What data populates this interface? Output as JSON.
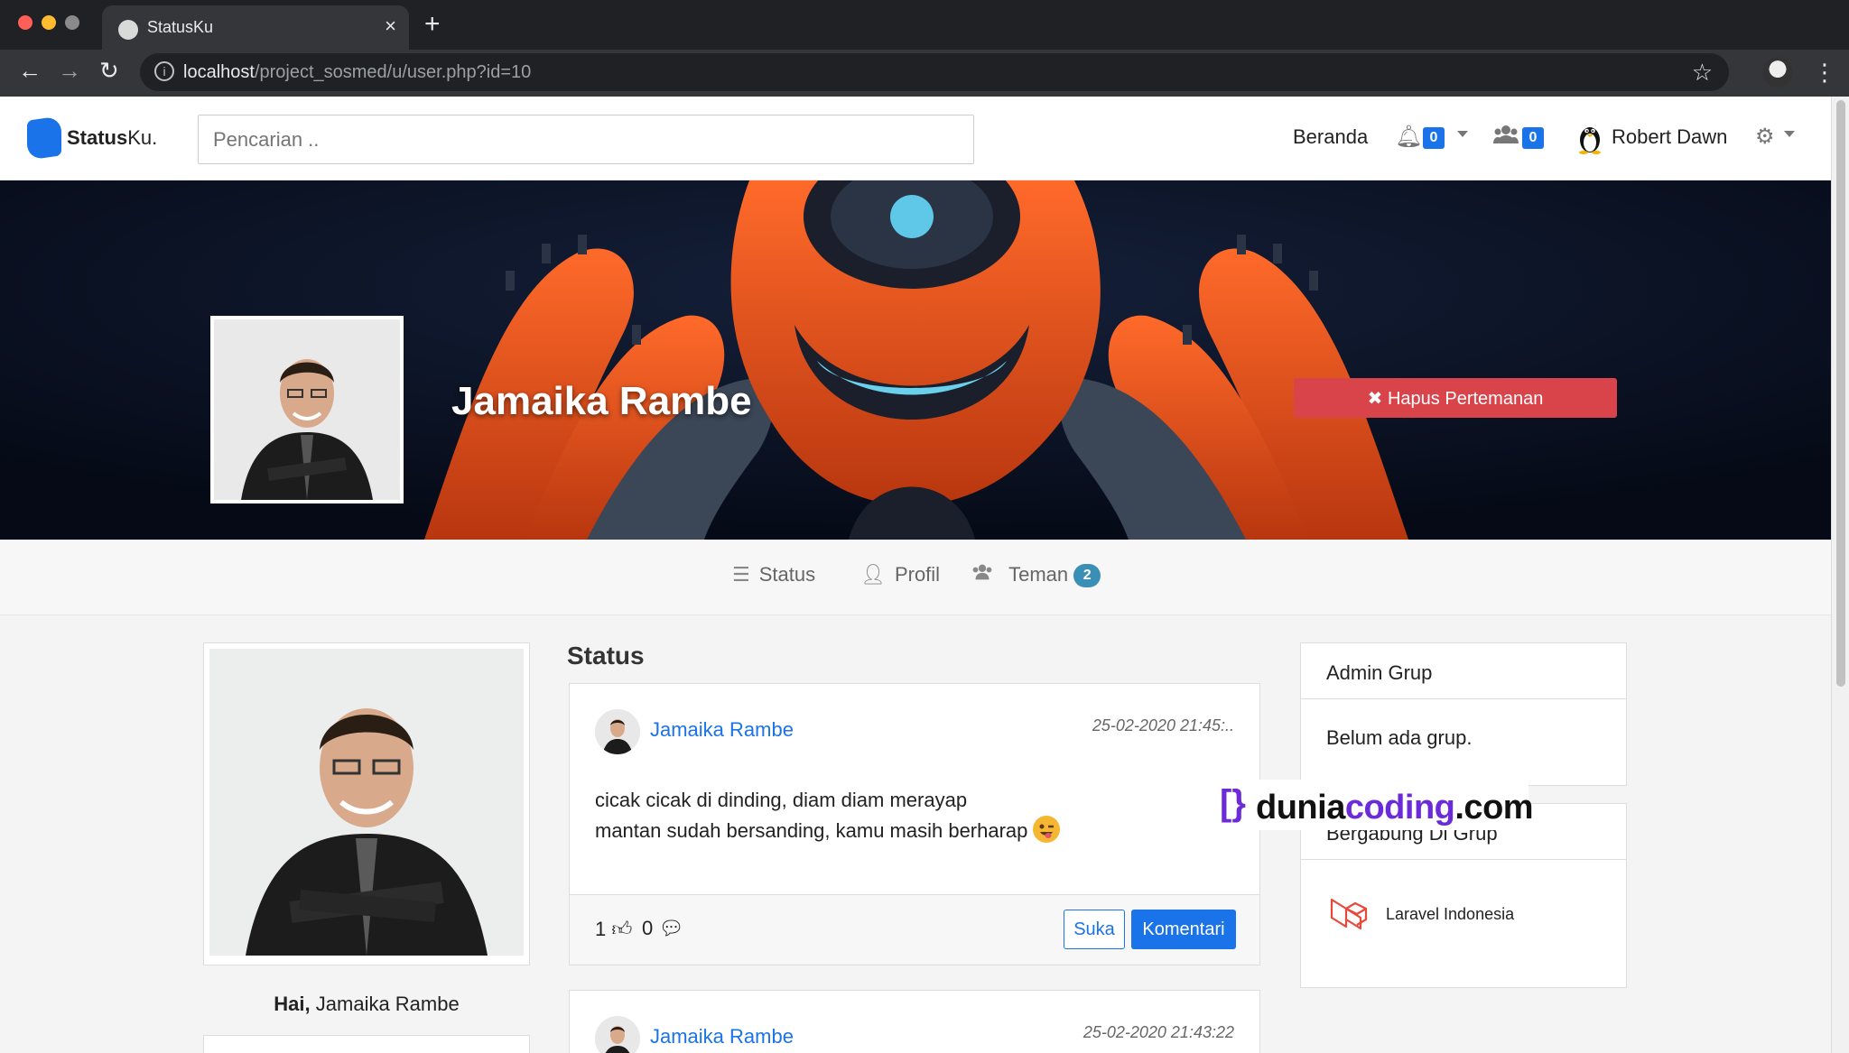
{
  "browser": {
    "tab_title": "StatusKu",
    "url_host": "localhost",
    "url_path": "/project_sosmed/u/user.php?id=10"
  },
  "app": {
    "logo_bold": "Status",
    "logo_rest": "Ku.",
    "search_placeholder": "Pencarian ..",
    "nav_home": "Beranda",
    "notif_count": "0",
    "friend_req_count": "0",
    "user_name": "Robert Dawn"
  },
  "profile": {
    "name": "Jamaika Rambe",
    "unfriend_label": "✖ Hapus Pertemanan",
    "tabs": [
      {
        "label": "Status"
      },
      {
        "label": "Profil"
      },
      {
        "label": "Teman",
        "badge": "2"
      }
    ],
    "greeting_prefix": "Hai,",
    "greeting_name": "Jamaika Rambe"
  },
  "feed": {
    "heading": "Status",
    "posts": [
      {
        "author": "Jamaika Rambe",
        "time": "25-02-2020 21:45:..",
        "line1": "cicak cicak di dinding, diam diam merayap",
        "line2": "mantan sudah bersanding, kamu masih berharap",
        "likes": "1",
        "comments": "0",
        "like_btn": "Suka",
        "comment_btn": "Komentari"
      },
      {
        "author": "Jamaika Rambe",
        "time": "25-02-2020 21:43:22"
      }
    ]
  },
  "sidebar": {
    "admin_title": "Admin Grup",
    "admin_empty": "Belum ada grup.",
    "joined_title": "Bergabung Di Grup",
    "joined_groups": [
      {
        "name": "Laravel Indonesia"
      }
    ]
  },
  "watermark": {
    "bracket": "[}",
    "text_a": "dunia",
    "text_b": "coding",
    "text_c": ".com"
  },
  "colors": {
    "accent": "#1a73e8",
    "danger": "#d9434a",
    "badge_teal": "#3a8fb7",
    "watermark_purple": "#6c2bd9"
  }
}
